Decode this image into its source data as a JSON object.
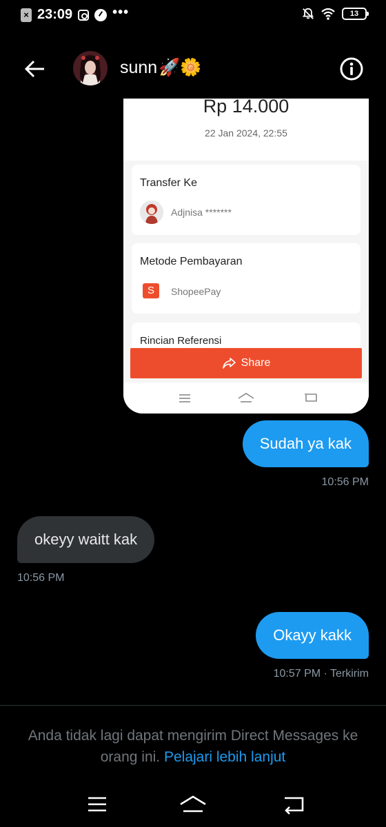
{
  "status_bar": {
    "time": "23:09",
    "dots": "•••",
    "battery": "13",
    "icons": [
      "close-app-icon",
      "instagram-icon",
      "speed-gauge-icon",
      "bell-off-icon",
      "wifi-icon",
      "battery-icon"
    ]
  },
  "header": {
    "name": "sunn",
    "emojis": "🚀🌼",
    "icons": [
      "back-arrow-icon",
      "info-icon"
    ]
  },
  "shared_image": {
    "amount": "Rp 14.000",
    "date": "22 Jan 2024, 22:55",
    "transfer_title": "Transfer Ke",
    "recipient": "Adjnisa *******",
    "payment_title": "Metode Pembayaran",
    "payment_method": "ShopeePay",
    "payment_icon_letter": "S",
    "partial_title": "Rincian Referensi",
    "share_label": "Share",
    "brand_color": "#ee4d2d"
  },
  "messages": [
    {
      "direction": "out",
      "text": "Sudah ya kak",
      "time": "10:56 PM"
    },
    {
      "direction": "in",
      "text": "okeyy waitt kak",
      "time": "10:56 PM"
    },
    {
      "direction": "out",
      "text": "Okayy kakk",
      "time": "10:57 PM · Terkirim"
    }
  ],
  "footer": {
    "notice": "Anda tidak lagi dapat mengirim Direct Messages ke orang ini.",
    "link": "Pelajari lebih lanjut"
  },
  "colors": {
    "background": "#000000",
    "outgoing_bubble": "#1d9bf0",
    "incoming_bubble": "#2f3336",
    "link": "#1d9bf0",
    "muted_text": "#71767b"
  }
}
